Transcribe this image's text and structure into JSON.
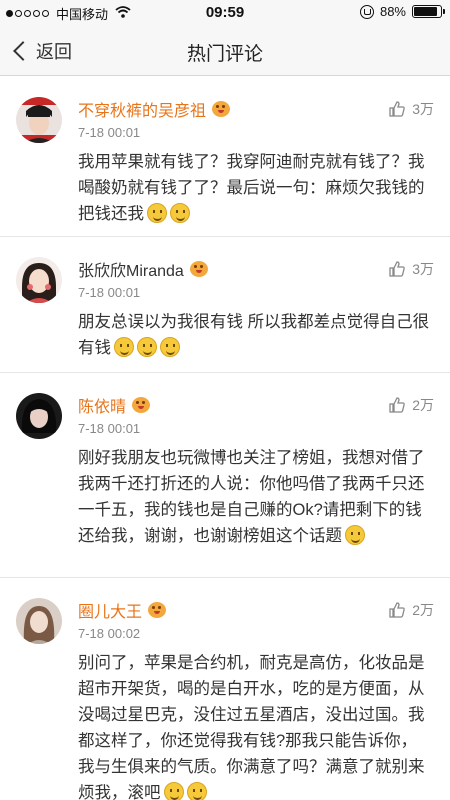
{
  "status_bar": {
    "carrier": "中国移动",
    "time": "09:59",
    "battery": "88%",
    "battery_level": 0.88
  },
  "nav": {
    "back_label": "返回",
    "title": "热门评论"
  },
  "comments": [
    {
      "username": "不穿秋裤的吴彦祖",
      "time": "7-18 00:01",
      "likes": "3万",
      "text": "我用苹果就有钱了？我穿阿迪耐克就有钱了？我喝酸奶就有钱了了？最后说一句：麻烦欠我钱的把钱还我",
      "emoji_count": 2
    },
    {
      "username": "张欣欣Miranda",
      "time": "7-18 00:01",
      "likes": "3万",
      "text": "朋友总误以为我很有钱 所以我都差点觉得自己很有钱",
      "emoji_count": 3
    },
    {
      "username": "陈依晴",
      "time": "7-18 00:01",
      "likes": "2万",
      "text": "刚好我朋友也玩微博也关注了榜姐，我想对借了我两千还打折还的人说：你他吗借了我两千只还一千五，我的钱也是自己赚的Ok?请把剩下的钱还给我，谢谢，也谢谢榜姐这个话题",
      "emoji_count": 1
    },
    {
      "username": "圈儿大王",
      "time": "7-18 00:02",
      "likes": "2万",
      "text": "别问了，苹果是合约机，耐克是高仿，化妆品是超市开架货，喝的是白开水，吃的是方便面，从没喝过星巴克，没住过五星酒店，没出过国。我都这样了，你还觉得我有钱?那我只能告诉你，我与生俱来的气质。你满意了吗？满意了就别来烦我，滚吧",
      "emoji_count": 2
    }
  ]
}
